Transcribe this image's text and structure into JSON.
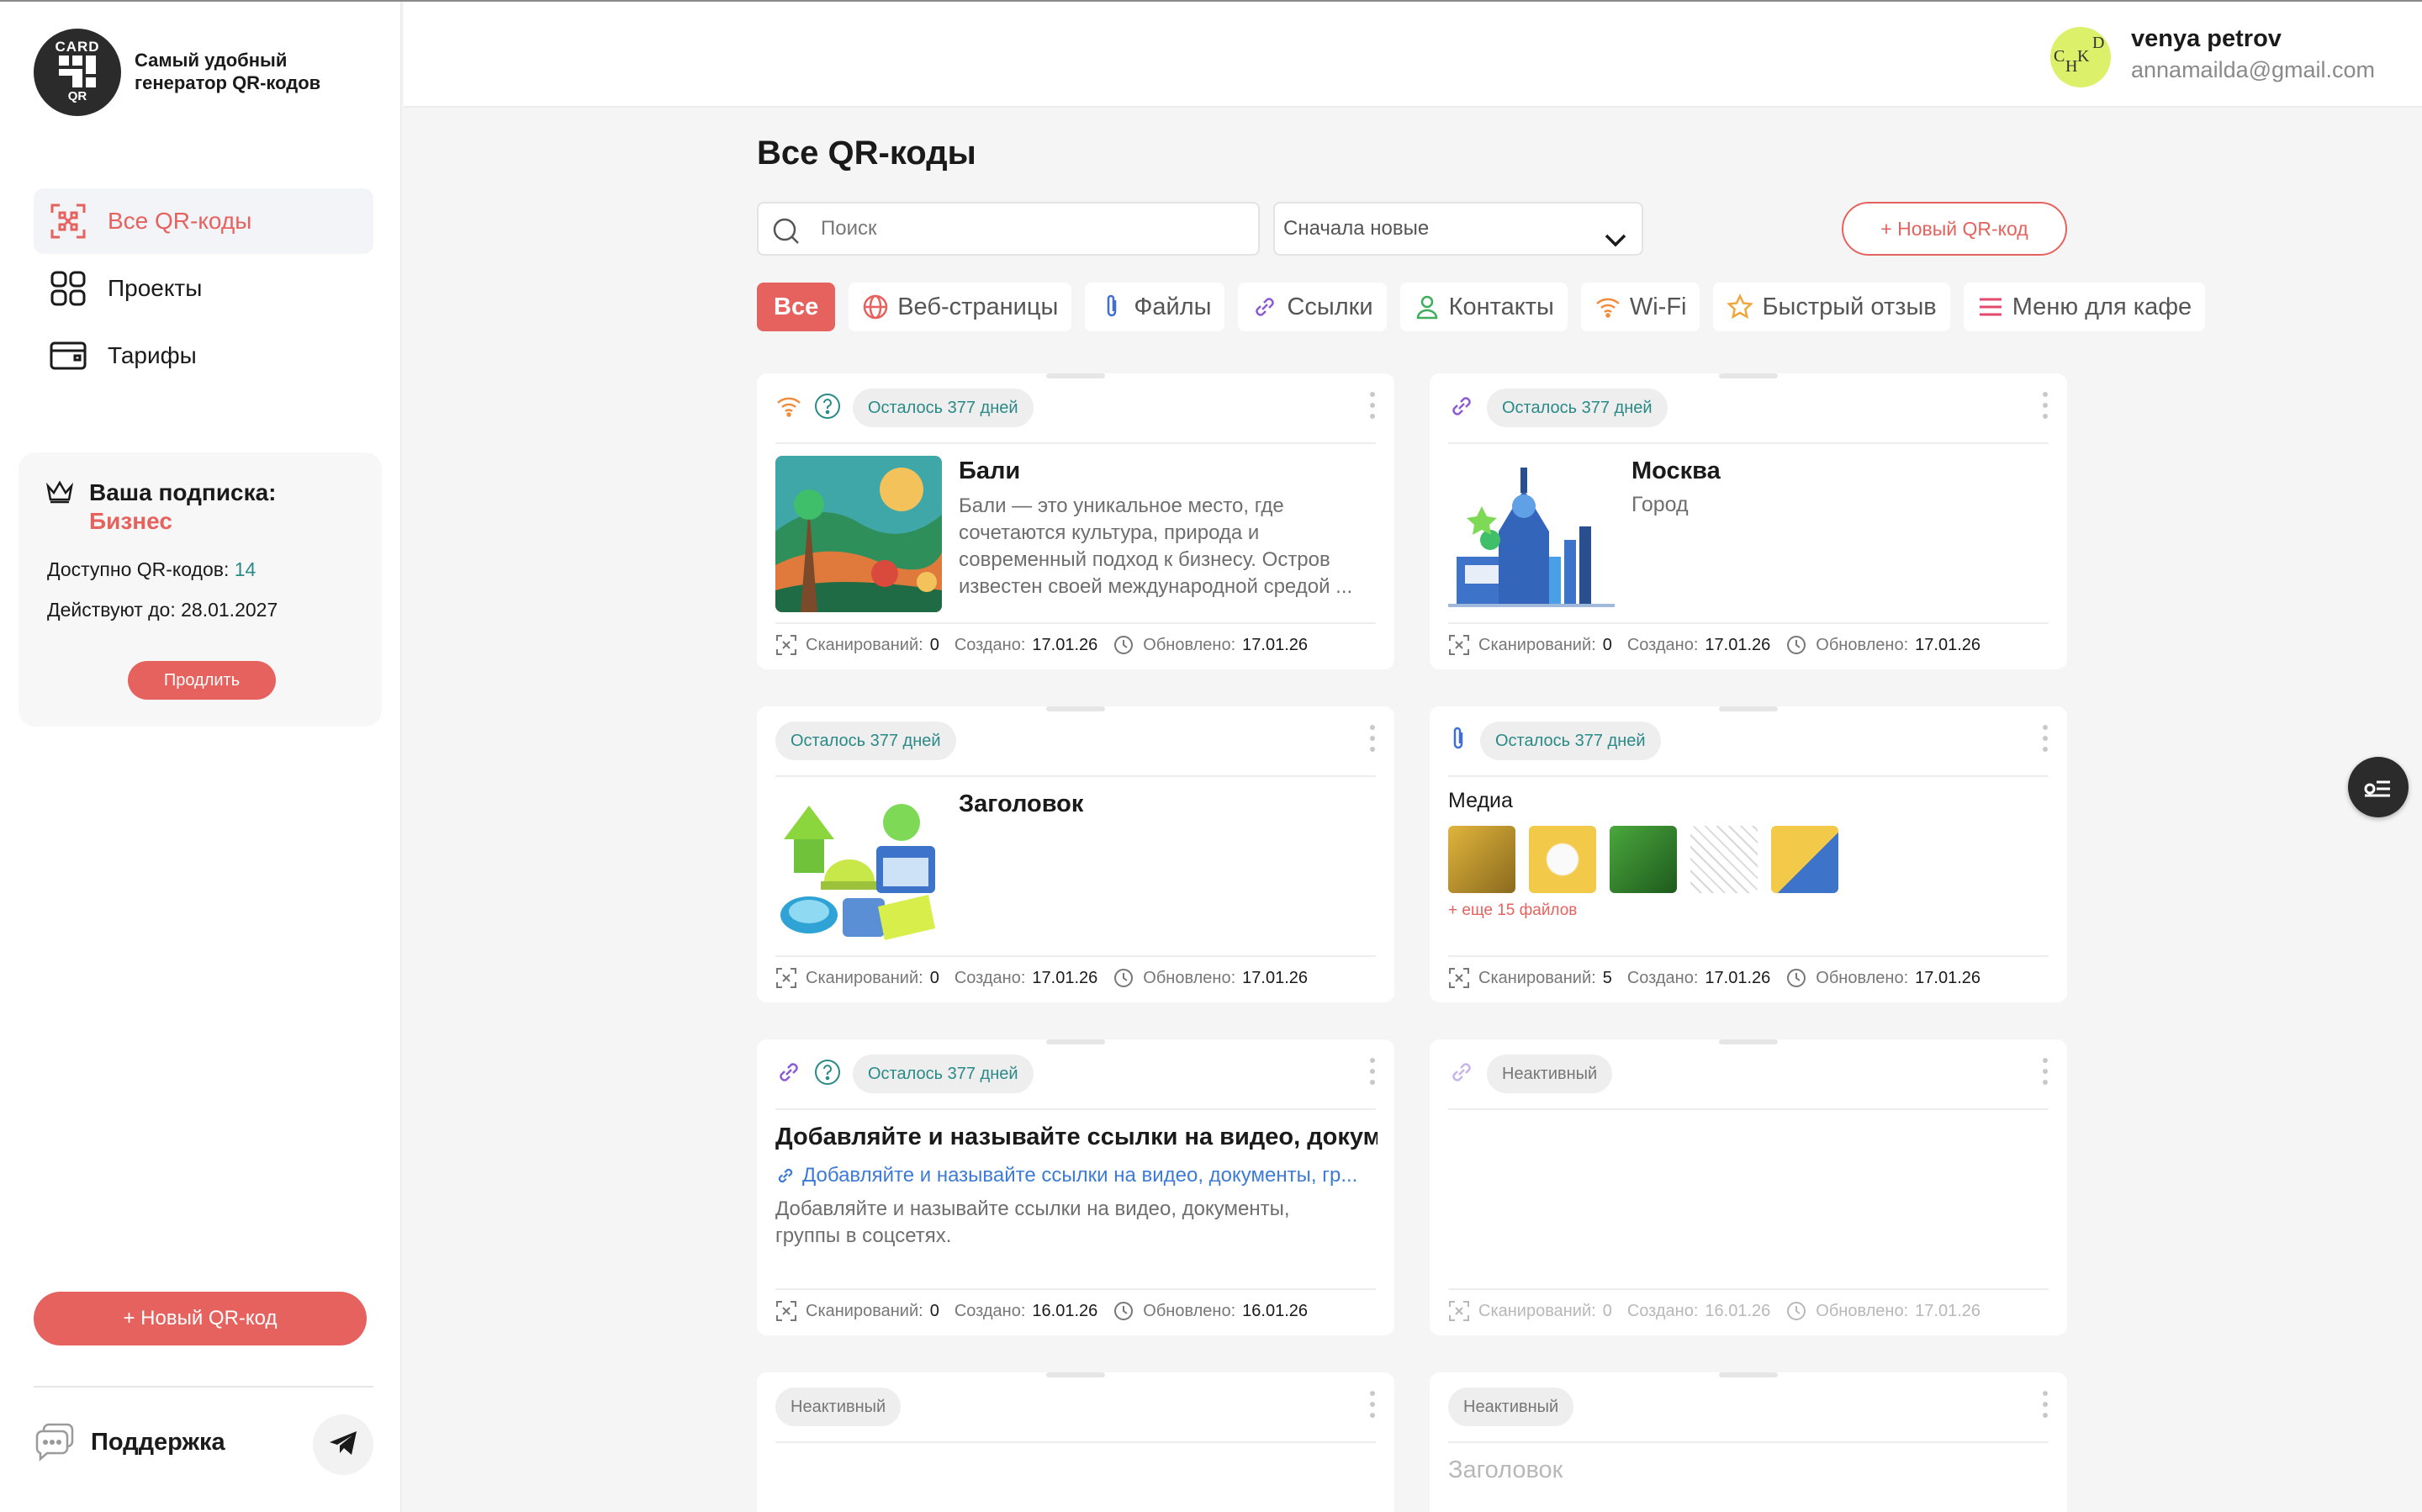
{
  "sidebar": {
    "logo_top": "CARD",
    "logo_bottom": "QR",
    "brand_line1": "Самый удобный",
    "brand_line2": "генератор QR-кодов",
    "nav": [
      {
        "label": "Все QR-коды",
        "icon": "qr-scan-icon",
        "active": true
      },
      {
        "label": "Проекты",
        "icon": "grid-icon",
        "active": false
      },
      {
        "label": "Тарифы",
        "icon": "wallet-icon",
        "active": false
      }
    ],
    "subscription": {
      "title": "Ваша подписка:",
      "plan": "Бизнес",
      "available_label": "Доступно QR-кодов:",
      "available_value": "14",
      "valid_label": "Действуют до:",
      "valid_value": "28.01.2027",
      "renew_label": "Продлить"
    },
    "new_button": "+ Новый QR-код",
    "support_label": "Поддержка"
  },
  "header": {
    "user_name": "venya petrov",
    "user_email": "annamailda@gmail.com",
    "avatar_letters": [
      "C",
      "H",
      "K",
      "D"
    ]
  },
  "main": {
    "title": "Все QR-коды",
    "search_placeholder": "Поиск",
    "sort_value": "Сначала новые",
    "new_button": "+ Новый QR-код",
    "filters": [
      {
        "label": "Все",
        "icon": "",
        "active": true
      },
      {
        "label": "Веб-страницы",
        "icon": "globe-icon"
      },
      {
        "label": "Файлы",
        "icon": "paperclip-icon"
      },
      {
        "label": "Ссылки",
        "icon": "link-icon"
      },
      {
        "label": "Контакты",
        "icon": "person-icon"
      },
      {
        "label": "Wi-Fi",
        "icon": "wifi-icon"
      },
      {
        "label": "Быстрый отзыв",
        "icon": "star-icon"
      },
      {
        "label": "Меню для кафе",
        "icon": "menu-icon"
      }
    ],
    "footer_labels": {
      "scans": "Сканирований:",
      "created": "Создано:",
      "updated": "Обновлено:"
    },
    "cards": [
      {
        "badge": "Осталось 377 дней",
        "title": "Бали",
        "desc": "Бали — это уникальное место, где сочетаются культура, природа и современный подход к бизнесу. Остров известен своей международной средой ...",
        "scans": "0",
        "created": "17.01.26",
        "updated": "17.01.26"
      },
      {
        "badge": "Осталось 377 дней",
        "title": "Москва",
        "subtitle": "Город",
        "scans": "0",
        "created": "17.01.26",
        "updated": "17.01.26"
      },
      {
        "badge": "Осталось 377 дней",
        "title": "Заголовок",
        "scans": "0",
        "created": "17.01.26",
        "updated": "17.01.26"
      },
      {
        "badge": "Осталось 377 дней",
        "media_title": "Медиа",
        "media_more": "+ еще 15 файлов",
        "scans": "5",
        "created": "17.01.26",
        "updated": "17.01.26"
      },
      {
        "badge": "Осталось 377 дней",
        "title": "Добавляйте и называйте ссылки на видео, докум...",
        "link": "Добавляйте и называйте ссылки на видео, документы, гр...",
        "desc": "Добавляйте и называйте ссылки на видео, документы, группы в соцсетях.",
        "scans": "0",
        "created": "16.01.26",
        "updated": "16.01.26"
      },
      {
        "badge": "Неактивный",
        "scans": "0",
        "created": "16.01.26",
        "updated": "17.01.26"
      },
      {
        "badge": "Неактивный"
      },
      {
        "badge": "Неактивный",
        "title": "Заголовок"
      }
    ]
  },
  "colors": {
    "accent": "#e5625e",
    "teal": "#2a8a87",
    "link": "#3d7bd6"
  }
}
